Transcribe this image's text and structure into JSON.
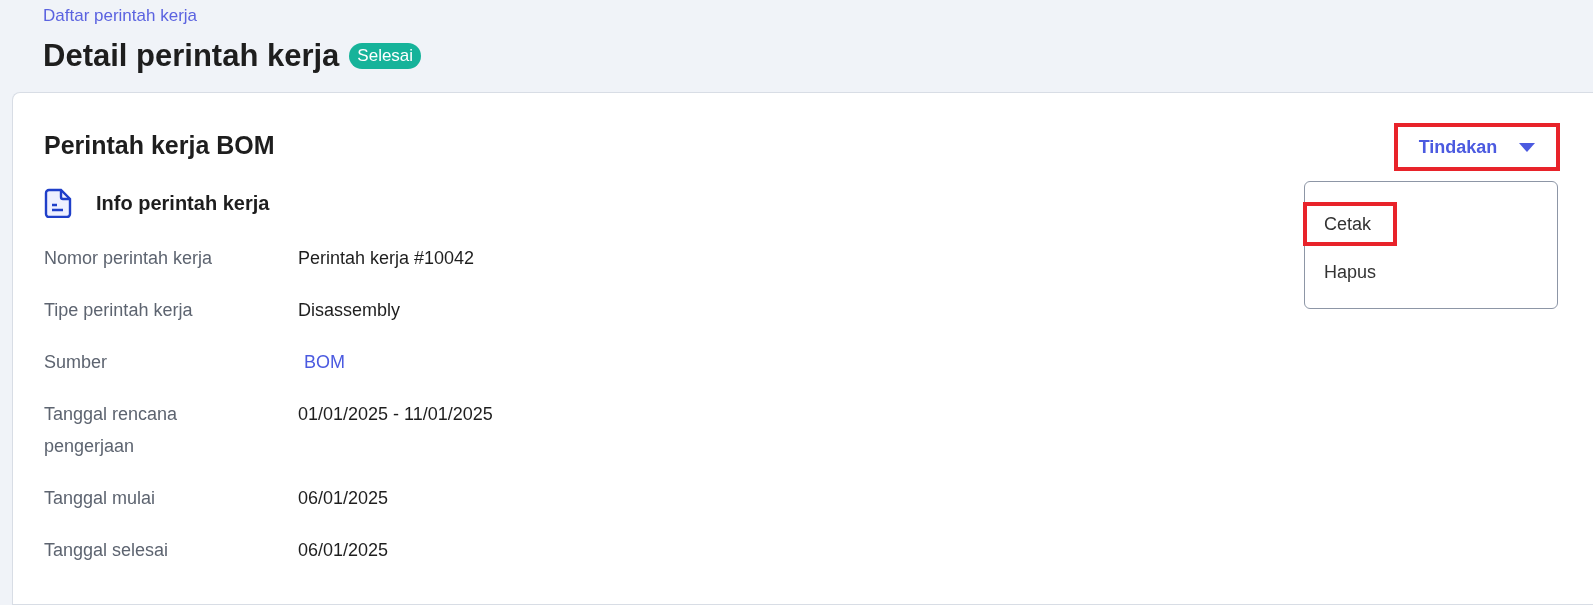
{
  "breadcrumb": "Daftar perintah kerja",
  "title": "Detail perintah kerja",
  "status_badge": "Selesai",
  "card": {
    "title": "Perintah kerja BOM",
    "actions": {
      "label": "Tindakan",
      "highlighted": true,
      "expanded": true,
      "menu": [
        {
          "label": "Cetak",
          "highlighted": true
        },
        {
          "label": "Hapus",
          "highlighted": false
        }
      ]
    },
    "section_title": "Info perintah kerja",
    "fields": [
      {
        "label": "Nomor perintah kerja",
        "value": "Perintah kerja #10042",
        "kind": "text"
      },
      {
        "label": "Tipe perintah kerja",
        "value": "Disassembly",
        "kind": "text"
      },
      {
        "label": "Sumber",
        "value": "BOM",
        "kind": "link"
      },
      {
        "label": "Tanggal rencana pengerjaan",
        "value": "01/01/2025 - 11/01/2025",
        "kind": "text"
      },
      {
        "label": "Tanggal mulai",
        "value": "06/01/2025",
        "kind": "text"
      },
      {
        "label": "Tanggal selesai",
        "value": "06/01/2025",
        "kind": "text"
      }
    ]
  }
}
